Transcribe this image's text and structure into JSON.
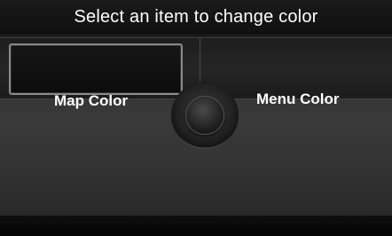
{
  "header": {
    "title": "Select an item to change color"
  },
  "options": [
    {
      "label": "Map Color",
      "selected": true
    },
    {
      "label": "Menu Color",
      "selected": false
    }
  ],
  "colors": {
    "background": "#2a2a2a",
    "title_bar": "#111111",
    "text": "#ffffff",
    "selection_border": "#8a8a8a"
  },
  "icons": {
    "center_control": "interface-dial"
  }
}
